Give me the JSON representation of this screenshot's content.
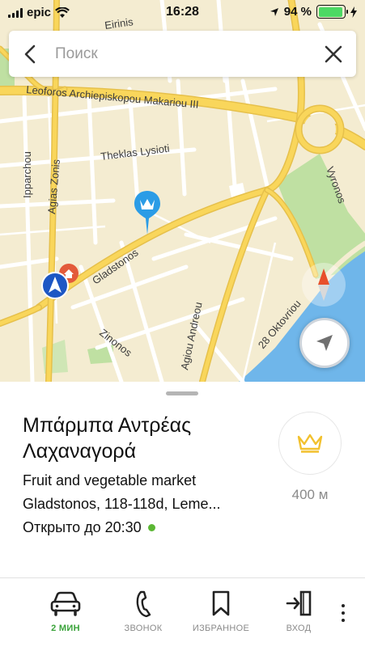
{
  "status_bar": {
    "carrier": "epic",
    "time": "16:28",
    "battery": "94 %",
    "battery_level": 0.94
  },
  "search": {
    "placeholder": "Поиск"
  },
  "map": {
    "streets": {
      "eirinis": "Eirinis",
      "makariou": "Leoforos Archiepiskopou Makariou III",
      "lysioti": "Theklas Lysioti",
      "zonis": "Agias Zonis",
      "ipparchou": "Ipparchou",
      "gladstonos": "Gladstonos",
      "vyronos": "Vyronos",
      "andreou": "Agiou Andreou",
      "oktovriou": "28 Oktovriou",
      "zinonos": "Zinonos"
    },
    "colors": {
      "land": "#f4ecd1",
      "minor_road": "#ffffff",
      "major_road": "#f9d65b",
      "park": "#bfe0a2",
      "water": "#6fb6ea",
      "pin": "#2b9ce6"
    }
  },
  "place": {
    "name": "Μπάρμπα Αντρέας Λαχαναγορά",
    "category": "Fruit and vegetable market",
    "address": "Gladstonos, 118-118d, Leme...",
    "hours": "Открыто до 20:30",
    "open_status_color": "#5bb734",
    "distance": "400 м",
    "badge_icon": "crown-icon"
  },
  "actions": [
    {
      "label": "2 МИН",
      "icon": "car-icon"
    },
    {
      "label": "ЗВОНОК",
      "icon": "phone-icon"
    },
    {
      "label": "ИЗБРАННОЕ",
      "icon": "bookmark-icon"
    },
    {
      "label": "ВХОД",
      "icon": "entrance-icon"
    }
  ]
}
